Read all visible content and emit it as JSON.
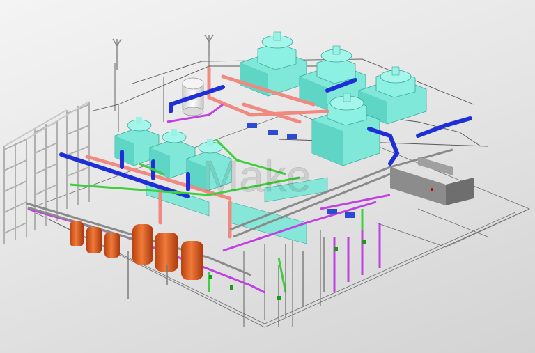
{
  "scene": {
    "watermark_text": "Make",
    "colors": {
      "tower_fill": "#7fe8d8",
      "tower_side": "#4fc2b2",
      "tower_top": "#9af2e6",
      "chilled_pipe": "#1f2fd6",
      "hot_pipe": "#f08a80",
      "condenser_pipe": "#3ecf3e",
      "magenta_pipe": "#c040e0",
      "tank_fill": "#e0581e",
      "scaffold": "#b8b8b8",
      "structure_line": "#5a5a5a",
      "vessel_fill": "#efefef"
    }
  }
}
